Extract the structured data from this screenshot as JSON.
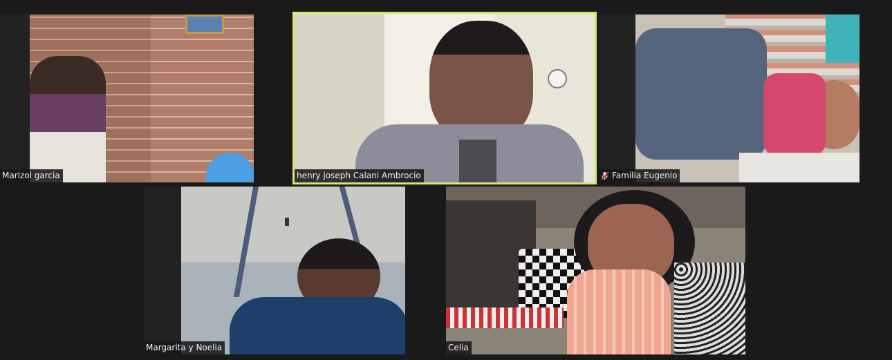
{
  "meeting": {
    "active_speaker_color": "#d7e76b",
    "participants": [
      {
        "name": "Marizol garcia",
        "muted": false
      },
      {
        "name": "henry joseph Calani Ambrocio",
        "muted": false,
        "active_speaker": true
      },
      {
        "name": "Familia Eugenio",
        "muted": true
      },
      {
        "name": "Margarita y Noelia",
        "muted": false
      },
      {
        "name": "Celia",
        "muted": false
      }
    ]
  }
}
